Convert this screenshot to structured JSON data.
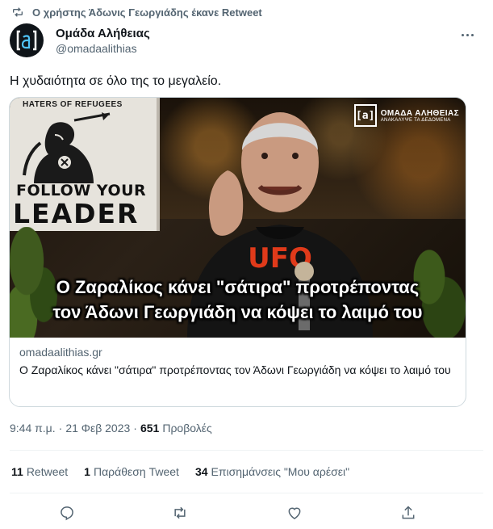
{
  "retweet_notice": "Ο χρήστης Άδωνις Γεωργιάδης έκανε Retweet",
  "author": {
    "display_name": "Ομάδα Αλήθειας",
    "handle": "@omadaalithias",
    "avatar_icon": "bracket-a-logo-icon"
  },
  "tweet": {
    "text": "Η χυδαιότητα σε όλο της το μεγαλείο."
  },
  "card": {
    "poster_top": "HATERS OF REFUGEES",
    "poster_line1": "FOLLOW YOUR",
    "poster_line2": "LEADER",
    "video_logo_box": "[a]",
    "video_logo_name": "ΟΜΑΔΑ ΑΛΗΘΕΙΑΣ",
    "video_logo_tag": "ΑΝΑΚΑΛΥΨΕ ΤΑ ΔΕΔΟΜΕΝΑ",
    "shirt_text": "UFO",
    "caption_line1": "Ο Ζαραλίκος κάνει \"σάτιρα\" προτρέποντας",
    "caption_line2": "τον Άδωνι Γεωργιάδη να κόψει το λαιμό του",
    "domain": "omadaalithias.gr",
    "title": "Ο Ζαραλίκος κάνει \"σάτιρα\" προτρέποντας τον Άδωνι Γεωργιάδη να κόψει το λαιμό του"
  },
  "meta": {
    "time": "9:44 π.μ.",
    "separator1": "·",
    "date": "21 Φεβ 2023",
    "separator2": "·",
    "views_count": "651",
    "views_label": "Προβολές"
  },
  "stats": {
    "retweets_count": "11",
    "retweets_label": "Retweet",
    "quotes_count": "1",
    "quotes_label": "Παράθεση Tweet",
    "likes_count": "34",
    "likes_label": "Επισημάνσεις \"Μου αρέσει\""
  },
  "actions": [
    "reply-icon",
    "retweet-icon",
    "like-icon",
    "share-icon"
  ],
  "colors": {
    "text_primary": "#0f1419",
    "text_secondary": "#536471",
    "border": "#cfd9de",
    "divider": "#eff3f4"
  }
}
